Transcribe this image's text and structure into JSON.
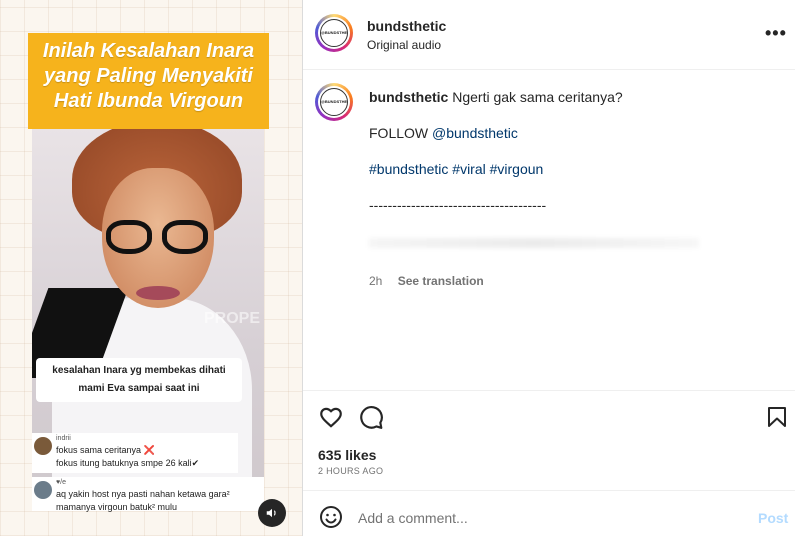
{
  "video": {
    "title": "Inilah Kesalahan Inara yang Paling Menyakiti Hati Ibunda Virgoun",
    "title_lines": [
      "Inilah Kesalahan Inara",
      "yang Paling Menyakiti",
      "Hati Ibunda Virgoun"
    ],
    "watermark": "PROPE",
    "caption_lines": [
      "kesalahan Inara yg membekas dihati",
      "mami Eva sampai saat ini"
    ],
    "comment1": {
      "user": "indrii",
      "line1": "fokus sama ceritanya",
      "line1_mark": "❌",
      "line2": "fokus itung batuknya smpe 26 kali",
      "line2_mark": "✔"
    },
    "comment2": {
      "user": "♥/e",
      "line1": "aq yakin host nya pasti nahan ketawa gara²",
      "line2": "mamanya virgoun batuk² mulu"
    }
  },
  "post": {
    "username": "bundsthetic",
    "audio": "Original audio",
    "avatar_text": "@BUNDSTHETIC",
    "caption_user": "bundsthetic",
    "caption_text": "Ngerti gak sama ceritanya?",
    "follow_prefix": "FOLLOW ",
    "follow_handle": "@bundsthetic",
    "hashtags": "#bundsthetic #viral #virgoun",
    "dashes": "--------------------------------------",
    "age": "2h",
    "see_translation": "See translation",
    "likes": "635 likes",
    "time_ago": "2 HOURS AGO",
    "comment_placeholder": "Add a comment...",
    "post_label": "Post"
  },
  "colors": {
    "accent_yellow": "#f6b31c",
    "link": "#00376b",
    "post_disabled": "#b3dbff"
  },
  "icons": [
    "more-icon",
    "heart-icon",
    "comment-icon",
    "bookmark-icon",
    "emoji-icon",
    "sound-icon"
  ]
}
